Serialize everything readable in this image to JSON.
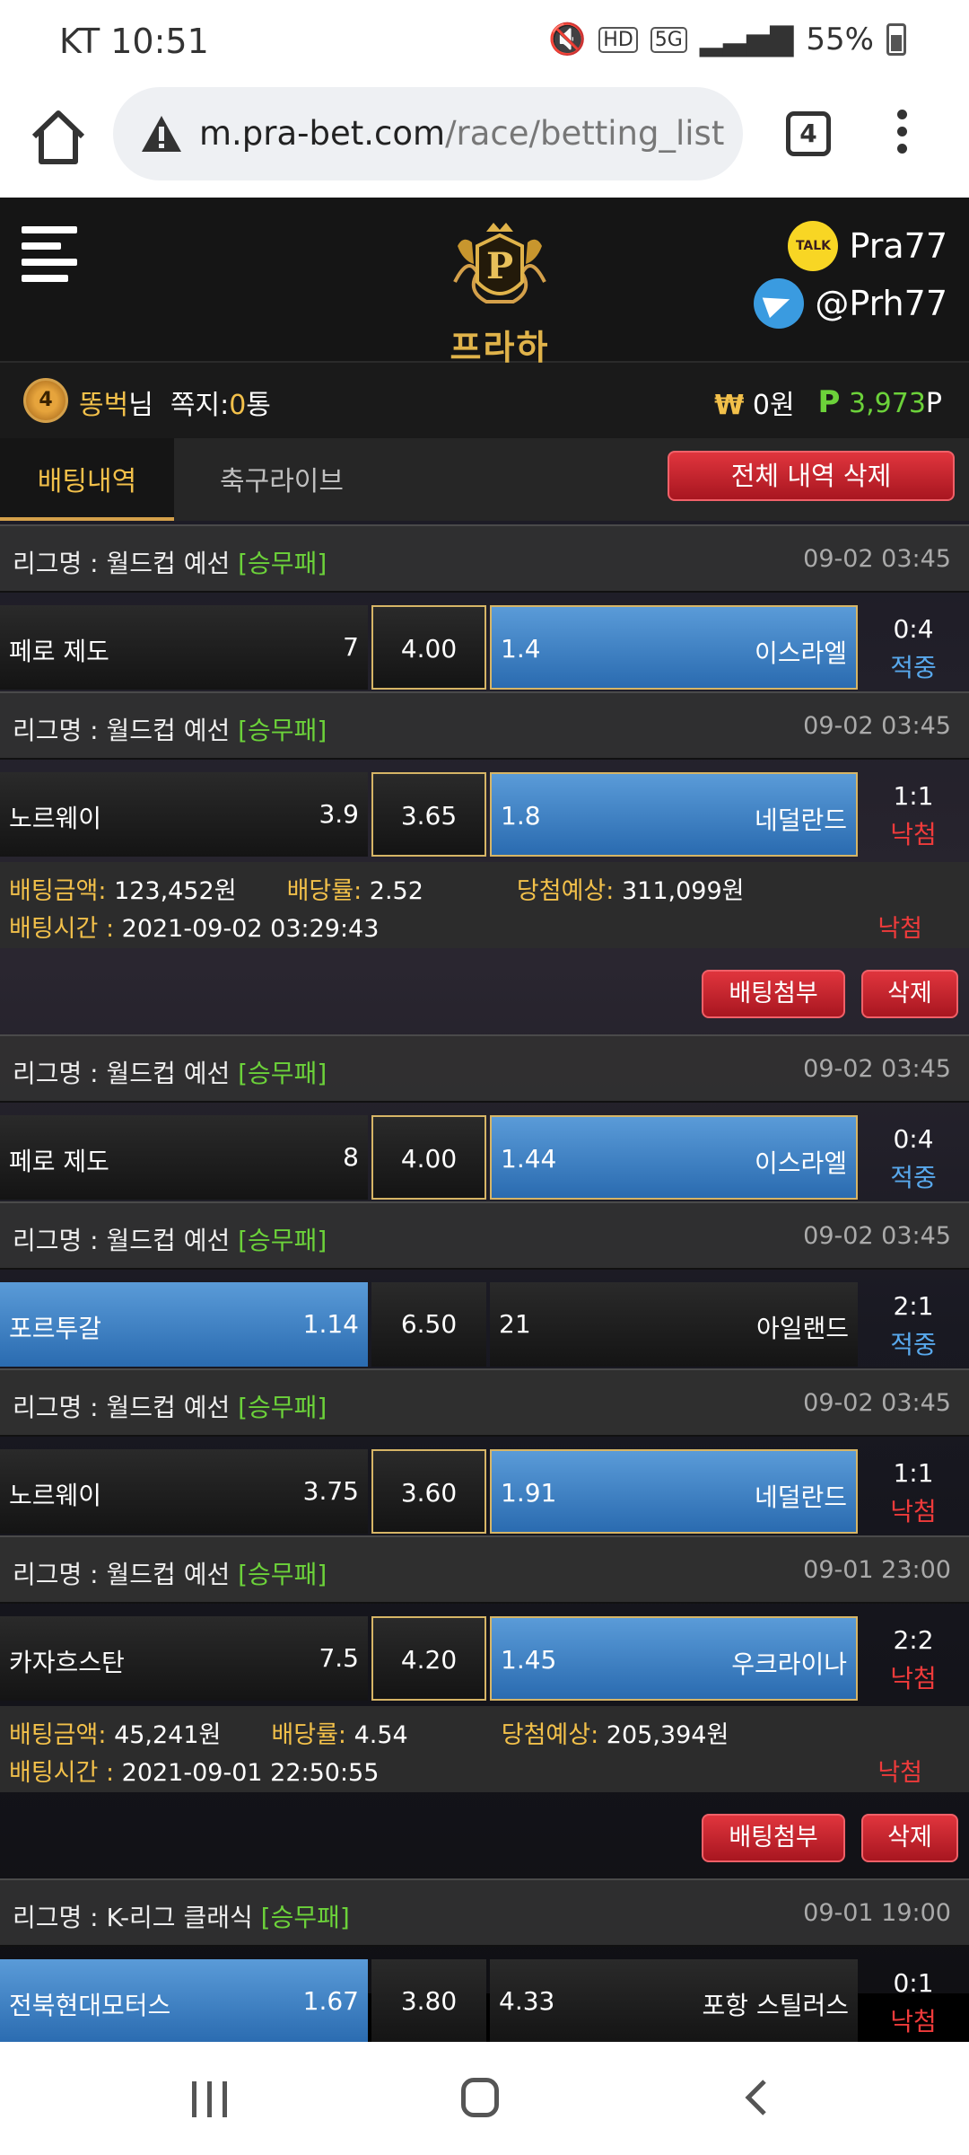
{
  "status_bar": {
    "carrier_time": "KT 10:51",
    "hd": "HD",
    "net": "5G",
    "battery": "55%"
  },
  "browser": {
    "url_domain": "m.pra-bet.com",
    "url_path": "/race/betting_list",
    "tab_count": "4"
  },
  "header": {
    "logo_text": "프라하",
    "kakao_label": "TALK",
    "kakao_id": "Pra77",
    "telegram_id": "@Prh77"
  },
  "user": {
    "level": "4",
    "nickname": "똥벅",
    "suffix": "님",
    "messages_label": "쪽지:",
    "messages_count": "0",
    "messages_unit": "통",
    "won_symbol": "₩",
    "balance": "0원",
    "point_symbol": "P",
    "points": "3,973",
    "points_unit": "P"
  },
  "tabs": {
    "betting_history": "배팅내역",
    "soccer_live": "축구라이브",
    "delete_all": "전체 내역 삭제"
  },
  "labels": {
    "league_prefix": "리그명 : ",
    "bet_amount": "배팅금액:",
    "dividend": "배당률:",
    "expected": "당첨예상:",
    "bet_time": "배팅시간 :",
    "attach_button": "배팅첨부",
    "delete_button": "삭제"
  },
  "colors": {
    "accent_gold": "#f2c04a",
    "win_blue": "#58a8ec",
    "loss_red": "#ef3b3b",
    "tag_green": "#6cd23a",
    "selected_blue": "#3a7fc4"
  },
  "slips": [
    {
      "games": [
        {
          "league": "월드컵 예선",
          "tag": "[승무패]",
          "date": "09-02 03:45",
          "home": "페로 제도",
          "home_odds": "7",
          "draw_odds": "4.00",
          "away_odds": "1.4",
          "away": "이스라엘",
          "selected": "away",
          "score": "0:4",
          "result": "적중"
        },
        {
          "league": "월드컵 예선",
          "tag": "[승무패]",
          "date": "09-02 03:45",
          "home": "노르웨이",
          "home_odds": "3.9",
          "draw_odds": "3.65",
          "away_odds": "1.8",
          "away": "네덜란드",
          "selected": "away",
          "score": "1:1",
          "result": "낙첨"
        }
      ],
      "amount": "123,452원",
      "rate": "2.52",
      "expected": "311,099원",
      "time": "2021-09-02 03:29:43",
      "result": "낙첨"
    },
    {
      "games": [
        {
          "league": "월드컵 예선",
          "tag": "[승무패]",
          "date": "09-02 03:45",
          "home": "페로 제도",
          "home_odds": "8",
          "draw_odds": "4.00",
          "away_odds": "1.44",
          "away": "이스라엘",
          "selected": "away",
          "score": "0:4",
          "result": "적중"
        },
        {
          "league": "월드컵 예선",
          "tag": "[승무패]",
          "date": "09-02 03:45",
          "home": "포르투갈",
          "home_odds": "1.14",
          "draw_odds": "6.50",
          "away_odds": "21",
          "away": "아일랜드",
          "selected": "home",
          "score": "2:1",
          "result": "적중"
        },
        {
          "league": "월드컵 예선",
          "tag": "[승무패]",
          "date": "09-02 03:45",
          "home": "노르웨이",
          "home_odds": "3.75",
          "draw_odds": "3.60",
          "away_odds": "1.91",
          "away": "네덜란드",
          "selected": "away",
          "score": "1:1",
          "result": "낙첨"
        },
        {
          "league": "월드컵 예선",
          "tag": "[승무패]",
          "date": "09-01 23:00",
          "home": "카자흐스탄",
          "home_odds": "7.5",
          "draw_odds": "4.20",
          "away_odds": "1.45",
          "away": "우크라이나",
          "selected": "away",
          "score": "2:2",
          "result": "낙첨"
        }
      ],
      "amount": "45,241원",
      "rate": "4.54",
      "expected": "205,394원",
      "time": "2021-09-01 22:50:55",
      "result": "낙첨"
    },
    {
      "games": [
        {
          "league": "K-리그 클래식",
          "tag": "[승무패]",
          "date": "09-01 19:00",
          "home": "전북현대모터스",
          "home_odds": "1.67",
          "draw_odds": "3.80",
          "away_odds": "4.33",
          "away": "포항 스틸러스",
          "selected": "home",
          "score": "0:1",
          "result": "낙첨"
        }
      ]
    }
  ]
}
